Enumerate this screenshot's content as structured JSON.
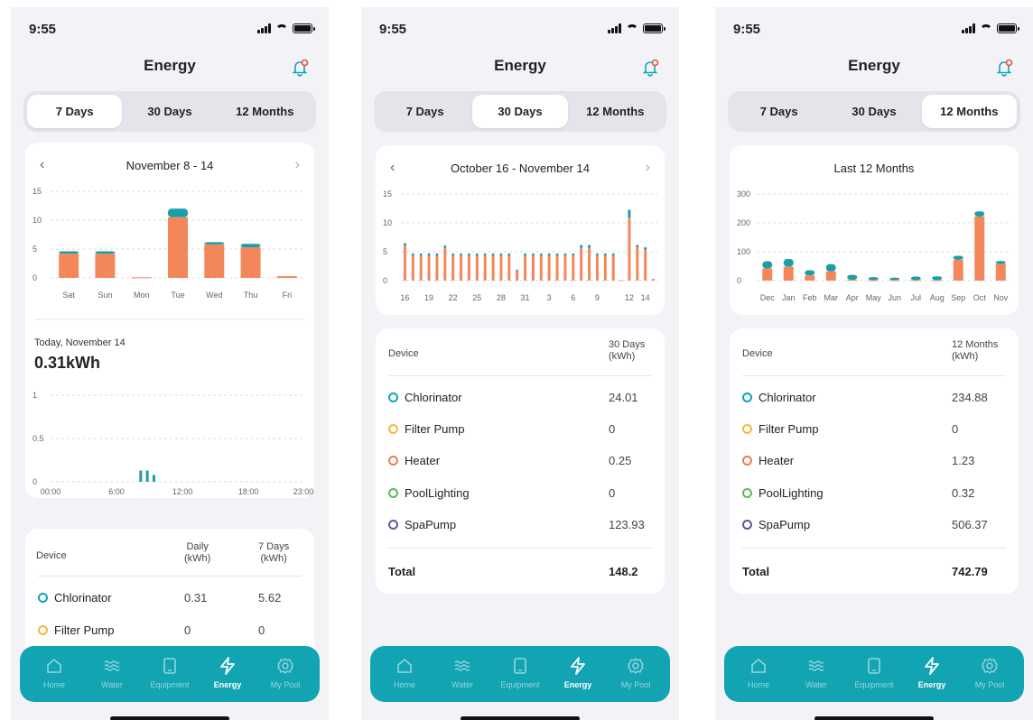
{
  "status": {
    "time": "9:55"
  },
  "screen_title": "Energy",
  "segments": [
    "7 Days",
    "30 Days",
    "12 Months"
  ],
  "colors": {
    "accent": "#12a4b2",
    "bar_main": "#f4875a",
    "bar_top": "#1a9ea9"
  },
  "nav": [
    {
      "label": "Home",
      "icon": "home-icon"
    },
    {
      "label": "Water",
      "icon": "water-icon"
    },
    {
      "label": "Equipment",
      "icon": "equipment-icon"
    },
    {
      "label": "Energy",
      "icon": "energy-icon"
    },
    {
      "label": "My Pool",
      "icon": "settings-icon"
    }
  ],
  "screen1": {
    "active_segment": "7 Days",
    "range": "November 8 - 14",
    "chart_data": {
      "type": "bar",
      "categories": [
        "Sat",
        "Sun",
        "Mon",
        "Tue",
        "Wed",
        "Thu",
        "Fri"
      ],
      "series": [
        {
          "values": [
            4.2,
            4.2,
            0.1,
            10.5,
            5.8,
            5.3,
            0.3
          ]
        },
        {
          "values": [
            0.4,
            0.4,
            0.0,
            1.5,
            0.4,
            0.6,
            0.0
          ]
        }
      ],
      "yticks": [
        "0",
        "5",
        "10",
        "15"
      ],
      "ylim": [
        0,
        15
      ]
    },
    "daily_label": "Today, November 14",
    "daily_value": "0.31kWh",
    "hourly_chart_data": {
      "type": "bar",
      "x_ticks": [
        "00:00",
        "6:00",
        "12:00",
        "18:00",
        "23:00"
      ],
      "yticks": [
        "0",
        "0.5",
        "1"
      ],
      "ylim": [
        0,
        1
      ],
      "hours": [
        8.2,
        8.8,
        9.4
      ],
      "values": [
        0.13,
        0.13,
        0.08
      ]
    },
    "table": {
      "col_device": "Device",
      "col_a": "Daily\n(kWh)",
      "col_b": "7 Days\n(kWh)",
      "rows": [
        {
          "name": "Chlorinator",
          "a": "0.31",
          "b": "5.62",
          "color": "#12a4b2"
        },
        {
          "name": "Filter Pump",
          "a": "0",
          "b": "0",
          "color": "#f5b93a"
        }
      ]
    }
  },
  "screen2": {
    "active_segment": "30 Days",
    "range": "October 16 - November 14",
    "chart_data": {
      "type": "bar",
      "x_ticks": [
        "16",
        "19",
        "22",
        "25",
        "28",
        "31",
        "3",
        "6",
        "9",
        "12",
        "14"
      ],
      "yticks": [
        "0",
        "5",
        "10",
        "15"
      ],
      "ylim": [
        0,
        15
      ],
      "series": [
        {
          "values": [
            6.0,
            4.3,
            4.3,
            4.3,
            4.3,
            5.6,
            4.3,
            4.3,
            4.3,
            4.3,
            4.3,
            4.3,
            4.3,
            4.3,
            1.6,
            4.3,
            4.3,
            4.3,
            4.3,
            4.3,
            4.3,
            4.3,
            5.6,
            5.6,
            4.3,
            4.3,
            4.3,
            0.1,
            10.8,
            5.7,
            5.3,
            0.3
          ]
        },
        {
          "values": [
            0.5,
            0.4,
            0.4,
            0.4,
            0.4,
            0.5,
            0.4,
            0.4,
            0.4,
            0.4,
            0.4,
            0.4,
            0.4,
            0.4,
            0.3,
            0.4,
            0.4,
            0.4,
            0.4,
            0.4,
            0.4,
            0.4,
            0.6,
            0.6,
            0.4,
            0.4,
            0.4,
            0.0,
            1.5,
            0.5,
            0.5,
            0.0
          ]
        }
      ]
    },
    "table": {
      "col_device": "Device",
      "col_a": "30 Days\n(kWh)",
      "rows": [
        {
          "name": "Chlorinator",
          "a": "24.01",
          "color": "#12a4b2"
        },
        {
          "name": "Filter Pump",
          "a": "0",
          "color": "#f5b93a"
        },
        {
          "name": "Heater",
          "a": "0.25",
          "color": "#f07a52"
        },
        {
          "name": "PoolLighting",
          "a": "0",
          "color": "#5cb85c"
        },
        {
          "name": "SpaPump",
          "a": "123.93",
          "color": "#5c5a9e"
        }
      ],
      "total_label": "Total",
      "total_value": "148.2"
    }
  },
  "screen3": {
    "active_segment": "12 Months",
    "range": "Last 12 Months",
    "chart_data": {
      "type": "bar",
      "categories": [
        "Dec",
        "Jan",
        "Feb",
        "Mar",
        "Apr",
        "May",
        "Jun",
        "Jul",
        "Aug",
        "Sep",
        "Oct",
        "Nov"
      ],
      "yticks": [
        "0",
        "100",
        "200",
        "300"
      ],
      "ylim": [
        0,
        300
      ],
      "series": [
        {
          "values": [
            42,
            48,
            18,
            32,
            3,
            2,
            2,
            2,
            2,
            72,
            222,
            58
          ]
        },
        {
          "values": [
            25,
            27,
            18,
            25,
            17,
            10,
            8,
            12,
            13,
            14,
            18,
            10
          ]
        }
      ]
    },
    "table": {
      "col_device": "Device",
      "col_a": "12 Months\n(kWh)",
      "rows": [
        {
          "name": "Chlorinator",
          "a": "234.88",
          "color": "#12a4b2"
        },
        {
          "name": "Filter Pump",
          "a": "0",
          "color": "#f5b93a"
        },
        {
          "name": "Heater",
          "a": "1.23",
          "color": "#f07a52"
        },
        {
          "name": "PoolLighting",
          "a": "0.32",
          "color": "#5cb85c"
        },
        {
          "name": "SpaPump",
          "a": "506.37",
          "color": "#5c5a9e"
        }
      ],
      "total_label": "Total",
      "total_value": "742.79"
    }
  }
}
